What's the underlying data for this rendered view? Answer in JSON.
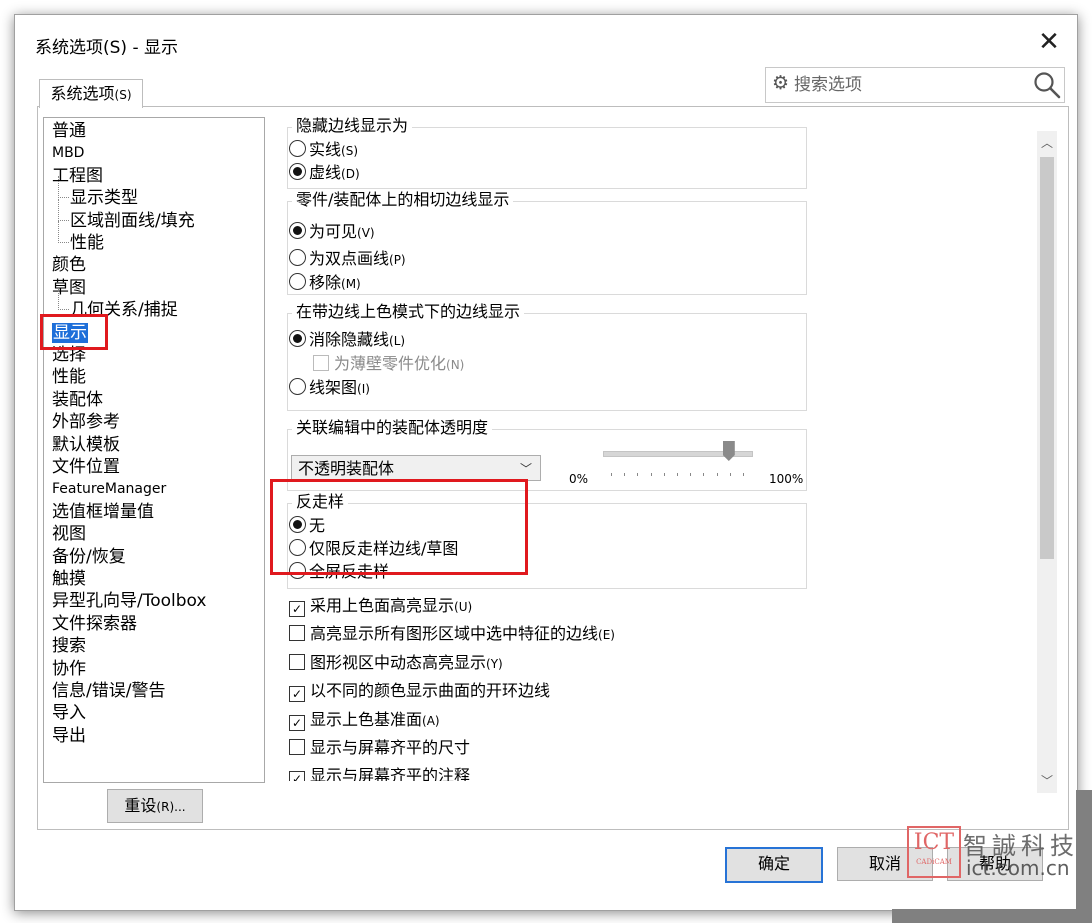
{
  "dialog": {
    "title": "系统选项(S) - 显示",
    "close_glyph": "✕"
  },
  "tab": {
    "label": "系统选项",
    "hotkey": "(S)"
  },
  "search": {
    "placeholder": "搜索选项"
  },
  "tree": [
    {
      "label": "普通",
      "level": 0
    },
    {
      "label": "MBD",
      "level": 0
    },
    {
      "label": "工程图",
      "level": 0
    },
    {
      "label": "显示类型",
      "level": 1
    },
    {
      "label": "区域剖面线/填充",
      "level": 1
    },
    {
      "label": "性能",
      "level": 1
    },
    {
      "label": "颜色",
      "level": 0
    },
    {
      "label": "草图",
      "level": 0
    },
    {
      "label": "几何关系/捕捉",
      "level": 1
    },
    {
      "label": "显示",
      "level": 0,
      "selected": true
    },
    {
      "label": "选择",
      "level": 0
    },
    {
      "label": "性能",
      "level": 0
    },
    {
      "label": "装配体",
      "level": 0
    },
    {
      "label": "外部参考",
      "level": 0
    },
    {
      "label": "默认模板",
      "level": 0
    },
    {
      "label": "文件位置",
      "level": 0
    },
    {
      "label": "FeatureManager",
      "level": 0
    },
    {
      "label": "选值框增量值",
      "level": 0
    },
    {
      "label": "视图",
      "level": 0
    },
    {
      "label": "备份/恢复",
      "level": 0
    },
    {
      "label": "触摸",
      "level": 0
    },
    {
      "label": "异型孔向导/Toolbox",
      "level": 0
    },
    {
      "label": "文件探索器",
      "level": 0
    },
    {
      "label": "搜索",
      "level": 0
    },
    {
      "label": "协作",
      "level": 0
    },
    {
      "label": "信息/错误/警告",
      "level": 0
    },
    {
      "label": "导入",
      "level": 0
    },
    {
      "label": "导出",
      "level": 0
    }
  ],
  "reset_button": {
    "label": "重设",
    "hotkey": "(R)..."
  },
  "groups": {
    "hidden_edges": {
      "title": "隐藏边线显示为",
      "options": [
        {
          "label": "实线",
          "hotkey": "(S)",
          "checked": false
        },
        {
          "label": "虚线",
          "hotkey": "(D)",
          "checked": true
        }
      ]
    },
    "tangent_edges": {
      "title": "零件/装配体上的相切边线显示",
      "options": [
        {
          "label": "为可见",
          "hotkey": "(V)",
          "checked": true
        },
        {
          "label": "为双点画线",
          "hotkey": "(P)",
          "checked": false
        },
        {
          "label": "移除",
          "hotkey": "(M)",
          "checked": false
        }
      ]
    },
    "shaded_edges": {
      "title": "在带边线上色模式下的边线显示",
      "options": [
        {
          "label": "消除隐藏线",
          "hotkey": "(L)",
          "checked": true
        },
        {
          "label": "线架图",
          "hotkey": "(I)",
          "checked": false
        }
      ],
      "sub_checkbox": {
        "label": "为薄壁零件优化",
        "hotkey": "(N)",
        "checked": false,
        "disabled": true
      }
    },
    "transparency": {
      "title": "关联编辑中的装配体透明度",
      "select_value": "不透明装配体",
      "slider_min_label": "0%",
      "slider_max_label": "100%",
      "slider_value_fraction": 0.85
    },
    "antialias": {
      "title": "反走样",
      "options": [
        {
          "label": "无",
          "hotkey": "",
          "checked": true
        },
        {
          "label": "仅限反走样边线/草图",
          "hotkey": "",
          "checked": false
        },
        {
          "label": "全屏反走样",
          "hotkey": "",
          "checked": false
        }
      ]
    }
  },
  "checkboxes": [
    {
      "label": "采用上色面高亮显示",
      "hotkey": "(U)",
      "checked": true
    },
    {
      "label": "高亮显示所有图形区域中选中特征的边线",
      "hotkey": "(E)",
      "checked": false
    },
    {
      "label": "图形视区中动态高亮显示",
      "hotkey": "(Y)",
      "checked": false
    },
    {
      "label": "以不同的颜色显示曲面的开环边线",
      "hotkey": "",
      "checked": true
    },
    {
      "label": "显示上色基准面",
      "hotkey": "(A)",
      "checked": true
    },
    {
      "label": "显示与屏幕齐平的尺寸",
      "hotkey": "",
      "checked": false
    },
    {
      "label": "显示与屏幕齐平的注释",
      "hotkey": "",
      "checked": true
    }
  ],
  "footer": {
    "ok": "确定",
    "cancel": "取消",
    "help": "帮助"
  },
  "watermark": {
    "logo_text": "ICT",
    "logo_sub": "CADiCAM",
    "cn_text": "智誠科技",
    "url": "ict.com.cn"
  },
  "colors": {
    "highlight_red": "#e0191e",
    "selection_blue": "#1e6fd9",
    "primary_border": "#2773d6"
  }
}
